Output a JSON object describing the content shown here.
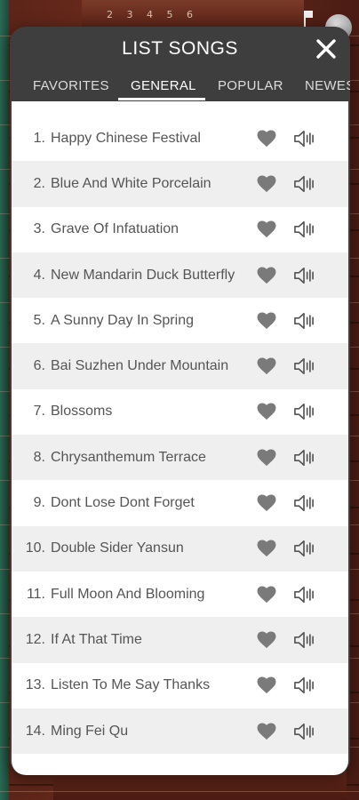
{
  "background": {
    "topbar_text": "2 3 4 5 6"
  },
  "modal": {
    "title": "LIST SONGS",
    "close_icon": "close-icon"
  },
  "tabs": [
    {
      "label": "FAVORITES",
      "active": false
    },
    {
      "label": "GENERAL",
      "active": true
    },
    {
      "label": "POPULAR",
      "active": false
    },
    {
      "label": "NEWES",
      "active": false
    }
  ],
  "songs": [
    {
      "num": "1.",
      "title": "Happy Chinese Festival"
    },
    {
      "num": "2.",
      "title": "Blue And White Porcelain"
    },
    {
      "num": "3.",
      "title": "Grave Of Infatuation"
    },
    {
      "num": "4.",
      "title": "New Mandarin Duck Butterfly"
    },
    {
      "num": "5.",
      "title": "A Sunny Day In Spring"
    },
    {
      "num": "6.",
      "title": "Bai Suzhen Under Mountain"
    },
    {
      "num": "7.",
      "title": "Blossoms"
    },
    {
      "num": "8.",
      "title": "Chrysanthemum Terrace"
    },
    {
      "num": "9.",
      "title": "Dont Lose Dont Forget"
    },
    {
      "num": "10.",
      "title": "Double Sider Yansun"
    },
    {
      "num": "11.",
      "title": "Full Moon And Blooming"
    },
    {
      "num": "12.",
      "title": "If At That Time"
    },
    {
      "num": "13.",
      "title": "Listen To Me Say Thanks"
    },
    {
      "num": "14.",
      "title": "Ming Fei Qu"
    }
  ],
  "colors": {
    "modal_bg": "#3e3e3e",
    "list_bg": "#ffffff",
    "alt_row": "#efefef",
    "icon_gray": "#7a7a7a",
    "text": "#555555"
  }
}
